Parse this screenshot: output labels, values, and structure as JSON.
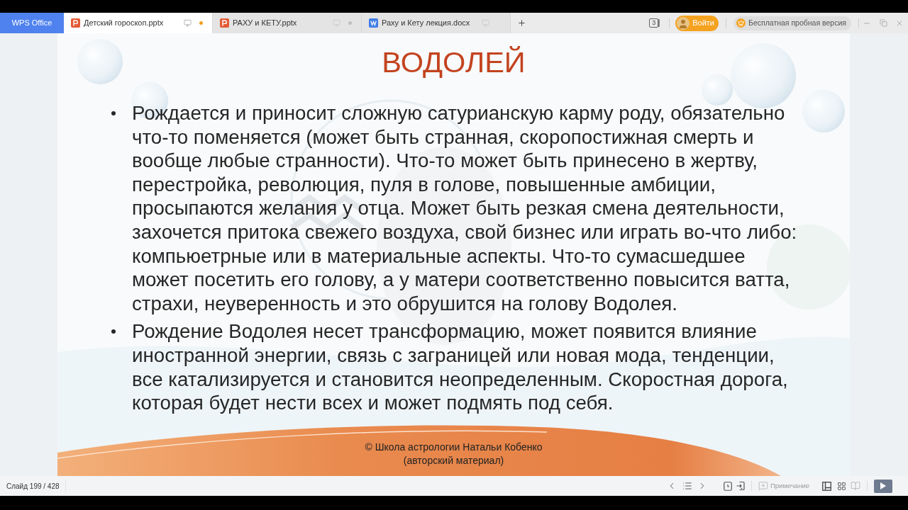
{
  "app_tab": {
    "label": "WPS Office"
  },
  "tabs": [
    {
      "label": "Детский гороскоп.pptx",
      "kind": "presentation",
      "selected": true,
      "modified": true
    },
    {
      "label": "РАХУ и КЕТУ.pptx",
      "kind": "presentation",
      "selected": false,
      "modified": true
    },
    {
      "label": "Раху и Кету лекция.docx",
      "kind": "document",
      "selected": false,
      "modified": false
    }
  ],
  "toolbar": {
    "window_count": "3",
    "login": "Войти",
    "trial": "Бесплатная пробная версия"
  },
  "slide": {
    "title": "ВОДОЛЕЙ",
    "bullets": [
      "Рождается и приносит сложную сатурианскую карму роду, обязательно что-то поменяется (может быть странная, скоропостижная смерть и вообще любые странности). Что-то может быть принесено в жертву, перестройка, революция, пуля в голове, повышенные амбиции, просыпаются желания у отца. Может быть резкая смена деятельности, захочется притока свежего воздуха, свой бизнес или играть во-что либо: компьюетрные или в материальные аспекты. Что-то сумасшедшее может посетить его голову, а у матери соответственно повысится ватта, страхи, неуверенность и это обрушится на голову Водолея.",
      "Рождение Водолея несет трансформацию, может появится влияние иностранной энергии, связь с заграницей или новая мода, тенденции, все катализируется и становится неопределенным. Скоростная дорога, которая будет нести всех и может подмять под себя."
    ],
    "footer": [
      "© Школа астрологии Натальи Кобенко",
      "(авторский материал)"
    ]
  },
  "status_bar": {
    "slide_counter": "Слайд 199 / 428",
    "note_button": {
      "label": "Примечание",
      "disabled": true
    }
  }
}
